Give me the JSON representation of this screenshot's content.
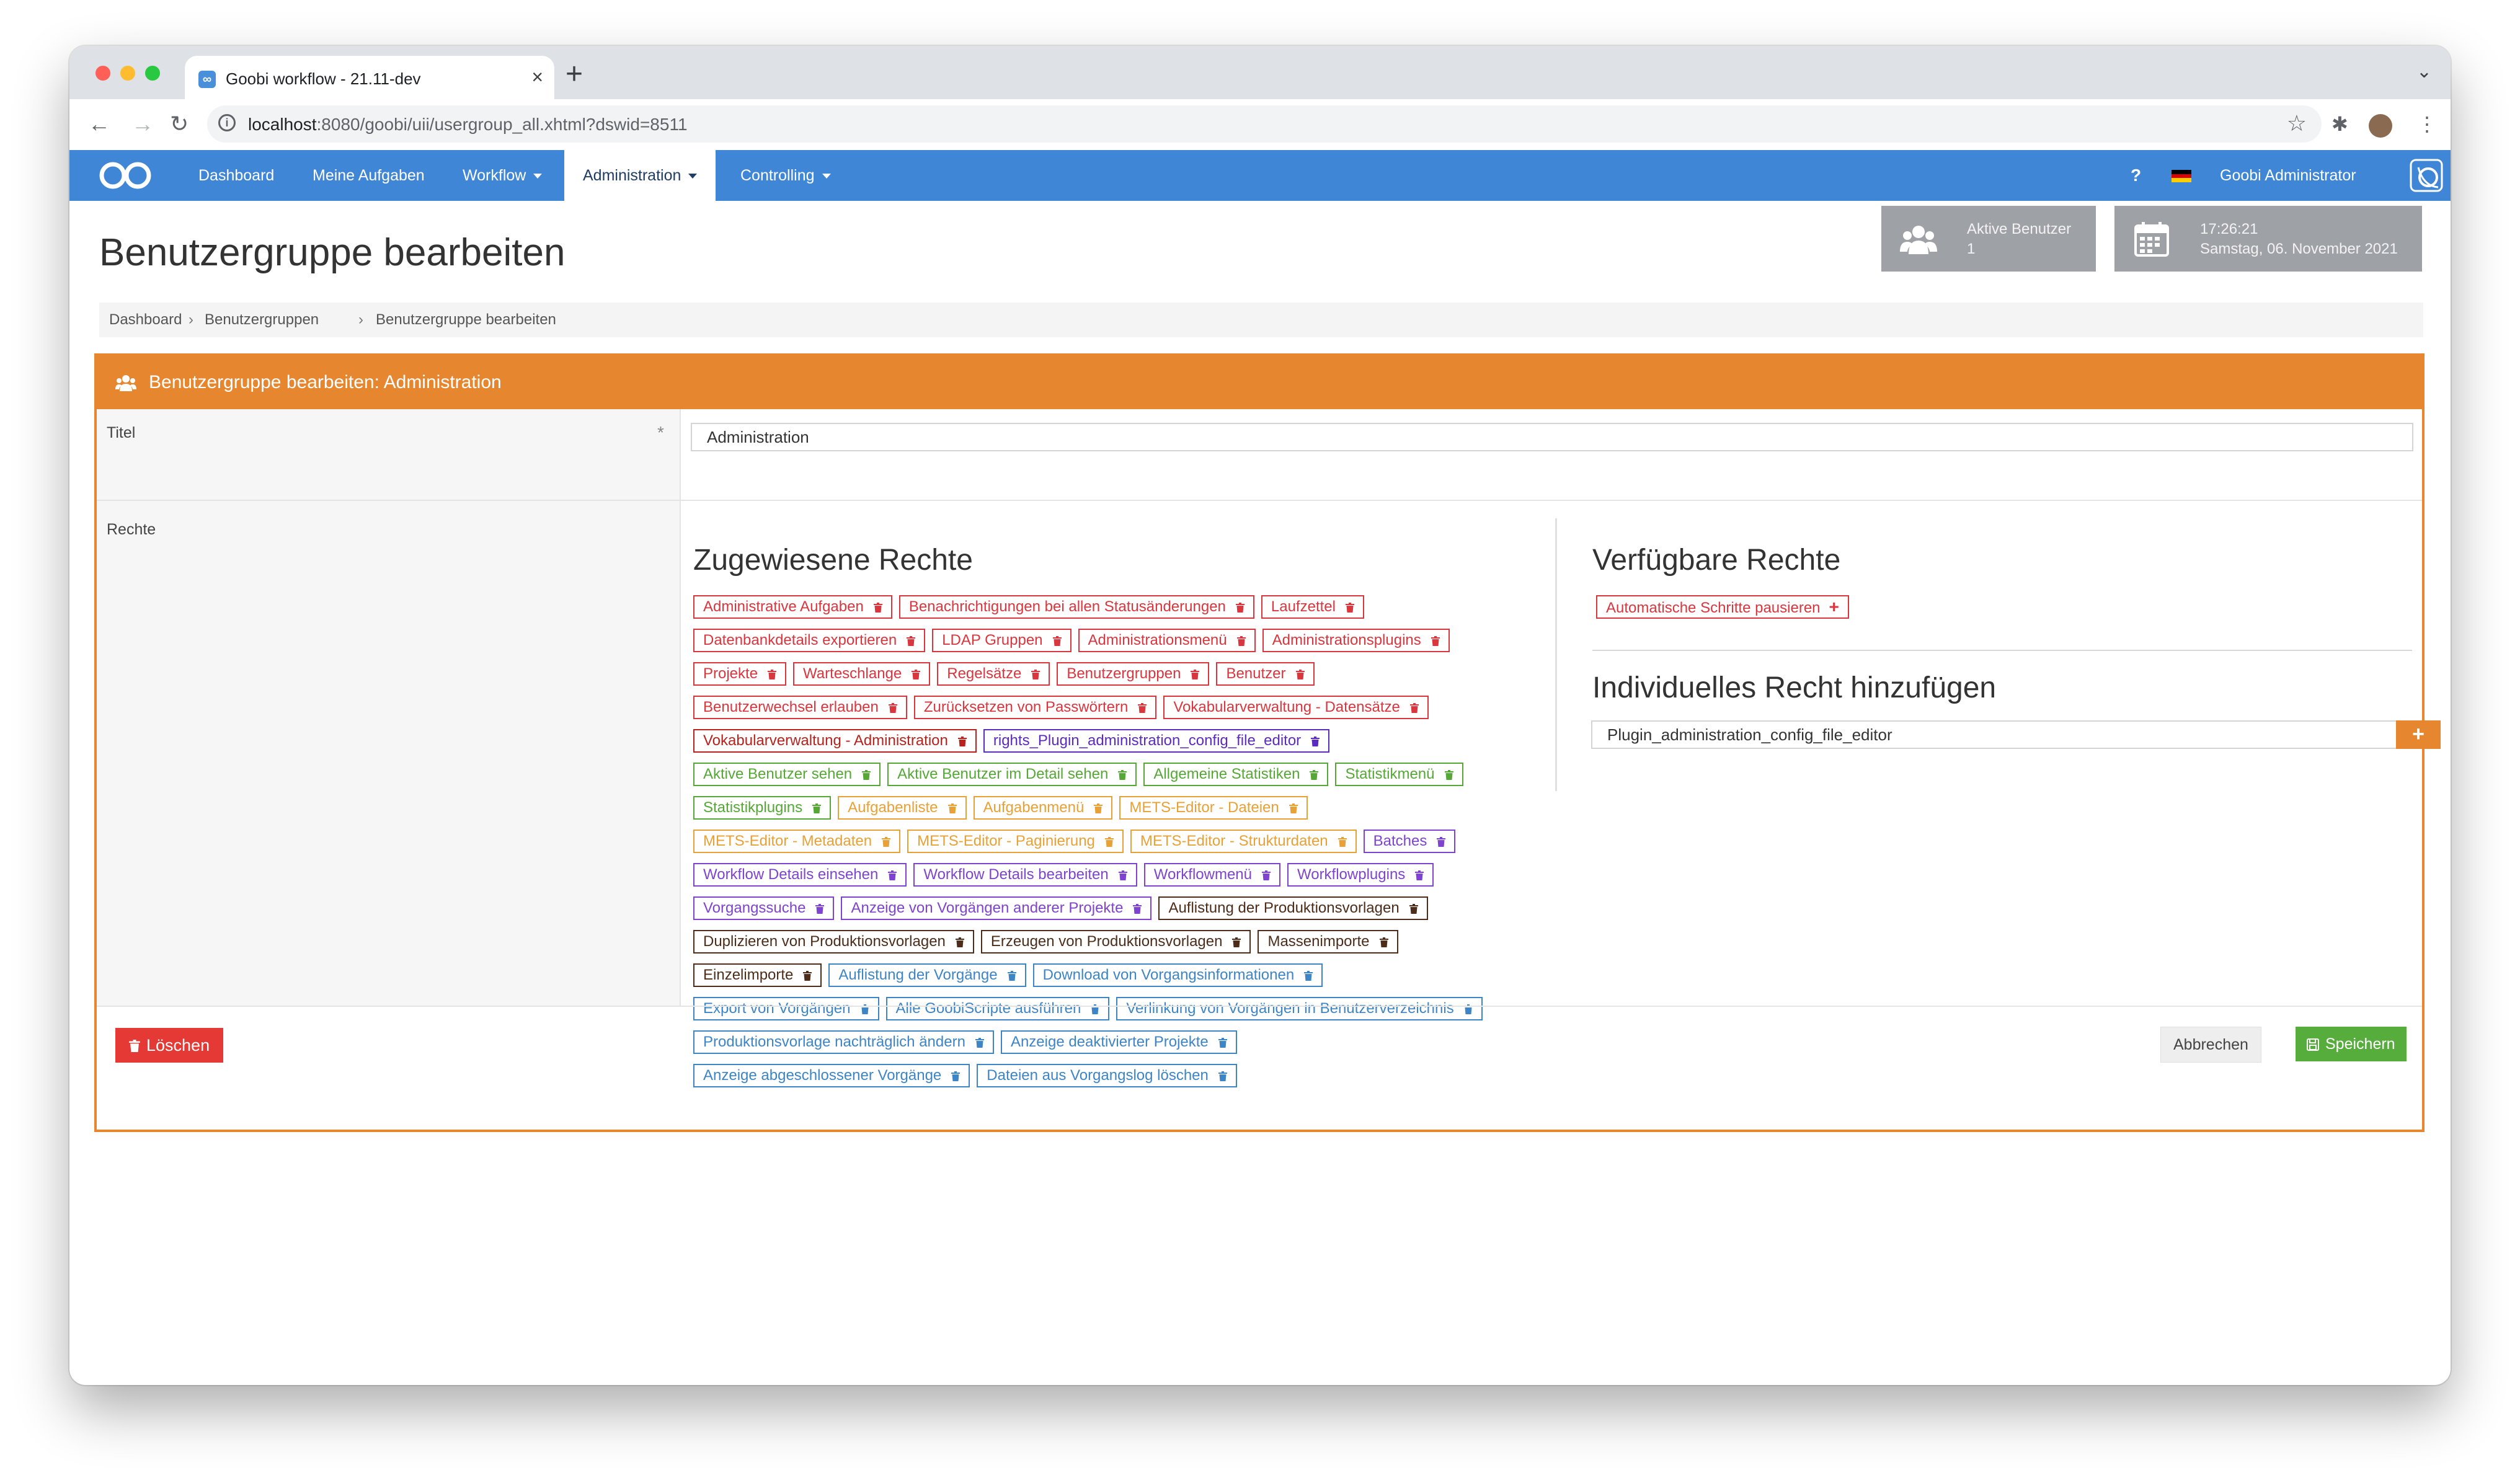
{
  "browser": {
    "tab_title": "Goobi workflow - 21.11-dev",
    "url_host": "localhost",
    "url_rest": ":8080/goobi/uii/usergroup_all.xhtml?dswid=8511"
  },
  "navbar": {
    "items": [
      {
        "label": "Dashboard"
      },
      {
        "label": "Meine Aufgaben"
      },
      {
        "label": "Workflow"
      },
      {
        "label": "Administration"
      },
      {
        "label": "Controlling"
      }
    ],
    "help": "?",
    "user": "Goobi Administrator",
    "brand_color": "#3f86d6"
  },
  "header": {
    "title": "Benutzergruppe bearbeiten",
    "active_users_label": "Aktive Benutzer",
    "active_users_value": "1",
    "time": "17:26:21",
    "date": "Samstag, 06. November 2021"
  },
  "breadcrumb": [
    "Dashboard",
    "Benutzergruppen",
    "Benutzergruppe bearbeiten"
  ],
  "box": {
    "title": "Benutzergruppe bearbeiten: Administration",
    "accent_color": "#e6872f",
    "title_label": "Titel",
    "required_mark": "*",
    "title_value": "Administration",
    "rights_label": "Rechte",
    "assigned_heading": "Zugewiesene Rechte",
    "available_heading": "Verfügbare Rechte",
    "individual_heading": "Individuelles Recht hinzufügen",
    "individual_value": "Plugin_administration_config_file_editor",
    "available": [
      {
        "label": "Automatische Schritte pausieren",
        "color": "red"
      }
    ],
    "assigned_rows": [
      [
        {
          "label": "Administrative Aufgaben",
          "color": "red"
        },
        {
          "label": "Benachrichtigungen bei allen Statusänderungen",
          "color": "red"
        },
        {
          "label": "Laufzettel",
          "color": "red"
        }
      ],
      [
        {
          "label": "Datenbankdetails exportieren",
          "color": "red"
        },
        {
          "label": "LDAP Gruppen",
          "color": "red"
        },
        {
          "label": "Administrationsmenü",
          "color": "red"
        },
        {
          "label": "Administrationsplugins",
          "color": "red"
        }
      ],
      [
        {
          "label": "Projekte",
          "color": "red"
        },
        {
          "label": "Warteschlange",
          "color": "red"
        },
        {
          "label": "Regelsätze",
          "color": "red"
        },
        {
          "label": "Benutzergruppen",
          "color": "red"
        },
        {
          "label": "Benutzer",
          "color": "red"
        }
      ],
      [
        {
          "label": "Benutzerwechsel erlauben",
          "color": "red"
        },
        {
          "label": "Zurücksetzen von Passwörtern",
          "color": "red"
        },
        {
          "label": "Vokabularverwaltung - Datensätze",
          "color": "red"
        }
      ],
      [
        {
          "label": "Vokabularverwaltung - Administration",
          "color": "darkred"
        },
        {
          "label": "rights_Plugin_administration_config_file_editor",
          "color": "purple"
        }
      ],
      [
        {
          "label": "Aktive Benutzer sehen",
          "color": "green"
        },
        {
          "label": "Aktive Benutzer im Detail sehen",
          "color": "green"
        },
        {
          "label": "Allgemeine Statistiken",
          "color": "green"
        },
        {
          "label": "Statistikmenü",
          "color": "green"
        }
      ],
      [
        {
          "label": "Statistikplugins",
          "color": "green"
        },
        {
          "label": "Aufgabenliste",
          "color": "orange"
        },
        {
          "label": "Aufgabenmenü",
          "color": "orange"
        },
        {
          "label": "METS-Editor - Dateien",
          "color": "orange"
        }
      ],
      [
        {
          "label": "METS-Editor - Metadaten",
          "color": "orange"
        },
        {
          "label": "METS-Editor - Paginierung",
          "color": "orange"
        },
        {
          "label": "METS-Editor - Strukturdaten",
          "color": "orange"
        },
        {
          "label": "Batches",
          "color": "violet"
        }
      ],
      [
        {
          "label": "Workflow Details einsehen",
          "color": "violet"
        },
        {
          "label": "Workflow Details bearbeiten",
          "color": "violet"
        },
        {
          "label": "Workflowmenü",
          "color": "violet"
        },
        {
          "label": "Workflowplugins",
          "color": "violet"
        }
      ],
      [
        {
          "label": "Vorgangssuche",
          "color": "violet"
        },
        {
          "label": "Anzeige von Vorgängen anderer Projekte",
          "color": "violet"
        },
        {
          "label": "Auflistung der Produktionsvorlagen",
          "color": "brown"
        }
      ],
      [
        {
          "label": "Duplizieren von Produktionsvorlagen",
          "color": "brown"
        },
        {
          "label": "Erzeugen von Produktionsvorlagen",
          "color": "brown"
        },
        {
          "label": "Massenimporte",
          "color": "brown"
        }
      ],
      [
        {
          "label": "Einzelimporte",
          "color": "brown"
        },
        {
          "label": "Auflistung der Vorgänge",
          "color": "blue"
        },
        {
          "label": "Download von Vorgangsinformationen",
          "color": "blue"
        }
      ],
      [
        {
          "label": "Export von Vorgängen",
          "color": "blue"
        },
        {
          "label": "Alle GoobiScripte ausführen",
          "color": "blue"
        },
        {
          "label": "Verlinkung von Vorgängen in Benutzerverzeichnis",
          "color": "blue"
        }
      ],
      [
        {
          "label": "Produktionsvorlage nachträglich ändern",
          "color": "blue"
        },
        {
          "label": "Anzeige deaktivierter Projekte",
          "color": "blue"
        }
      ],
      [
        {
          "label": "Anzeige abgeschlossener Vorgänge",
          "color": "blue"
        },
        {
          "label": "Dateien aus Vorgangslog löschen",
          "color": "blue"
        }
      ]
    ],
    "delete_label": "Löschen",
    "cancel_label": "Abbrechen",
    "save_label": "Speichern"
  }
}
